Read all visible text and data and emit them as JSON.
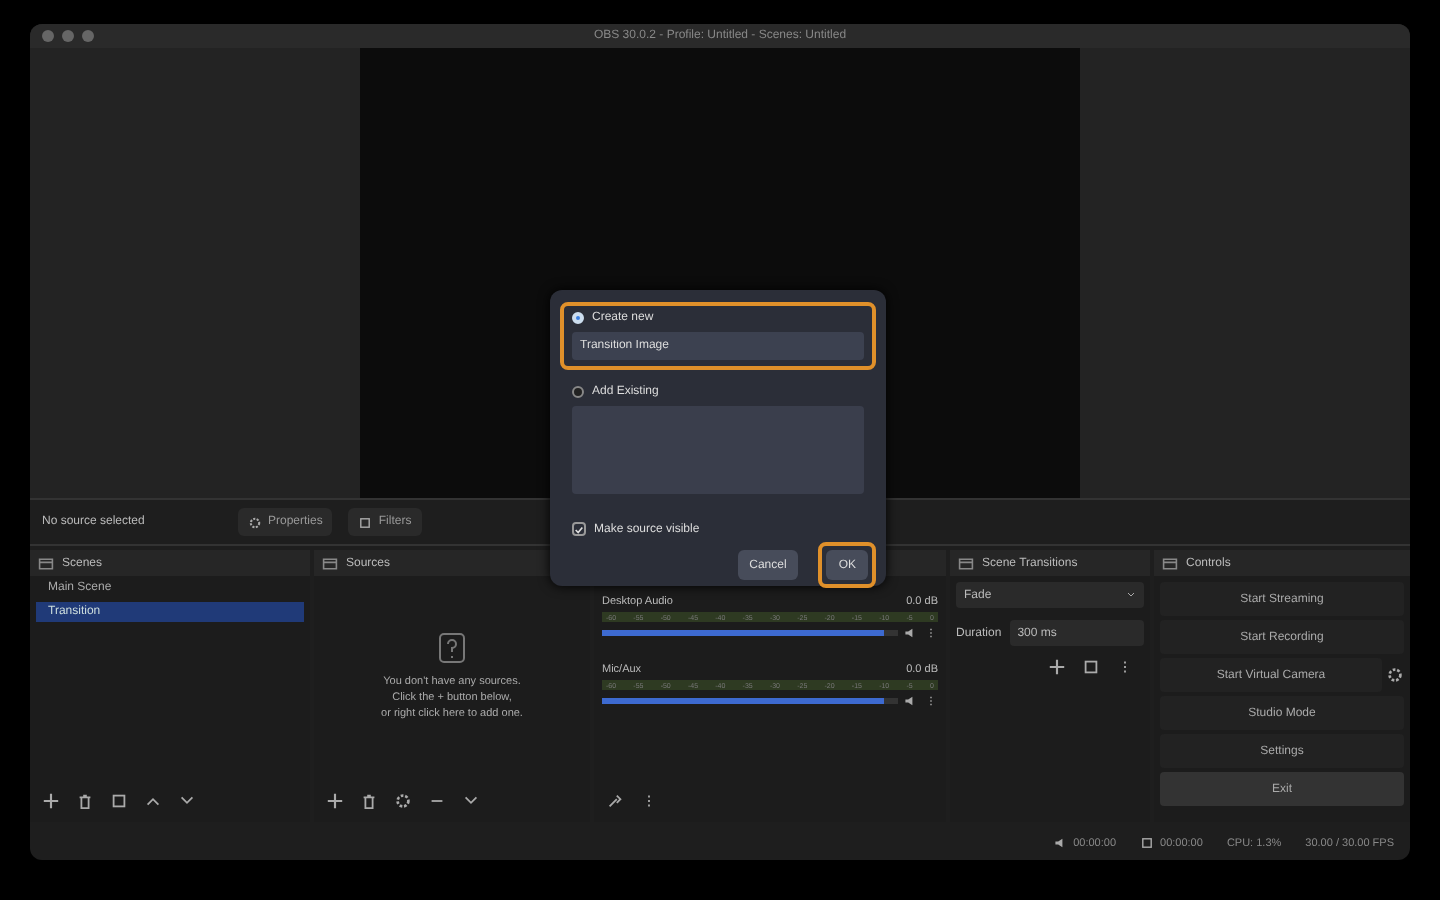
{
  "window": {
    "title": "OBS 30.0.2 - Profile: Untitled - Scenes: Untitled"
  },
  "source_toolbar": {
    "status": "No source selected",
    "buttons": [
      {
        "kind": "properties",
        "label": "Properties"
      },
      {
        "kind": "filters",
        "label": "Filters"
      }
    ]
  },
  "scenes": {
    "title": "Scenes",
    "items": [
      {
        "label": "Main Scene",
        "selected": false
      },
      {
        "label": "Transition",
        "selected": true
      }
    ]
  },
  "sources": {
    "title": "Sources",
    "empty_message": [
      "You don't have any sources.",
      "Click the + button below,",
      "or right click here to add one."
    ]
  },
  "mixer": {
    "channels": [
      {
        "name": "Desktop Audio",
        "reading": "0.0 dB",
        "level": 0.95,
        "scale": [
          "-60",
          "-55",
          "-50",
          "-45",
          "-40",
          "-35",
          "-30",
          "-25",
          "-20",
          "-15",
          "-10",
          "-5",
          "0"
        ]
      },
      {
        "name": "Mic/Aux",
        "reading": "0.0 dB",
        "level": 0.95,
        "scale": [
          "-60",
          "-55",
          "-50",
          "-45",
          "-40",
          "-35",
          "-30",
          "-25",
          "-20",
          "-15",
          "-10",
          "-5",
          "0"
        ]
      }
    ]
  },
  "transitions": {
    "title": "Scene Transitions",
    "transition": "Fade",
    "duration_label": "Duration",
    "duration": "300 ms"
  },
  "controls": {
    "title": "Controls",
    "buttons": [
      {
        "label": "Start Streaming",
        "kind": "plain"
      },
      {
        "label": "Start Recording",
        "kind": "plain"
      },
      {
        "label": "Start Virtual Camera",
        "kind": "with-settings"
      },
      {
        "label": "Studio Mode",
        "kind": "plain"
      },
      {
        "label": "Settings",
        "kind": "plain"
      },
      {
        "label": "Exit",
        "kind": "exit"
      }
    ]
  },
  "status_bar": {
    "stream_time": "00:00:00",
    "record_time": "00:00:00",
    "cpu": "CPU: 1.3%",
    "fps": "30.00 / 30.00 FPS"
  },
  "dialog": {
    "options": [
      {
        "kind": "create",
        "label": "Create new",
        "selected": true,
        "highlighted": true,
        "value": "Transition Image"
      },
      {
        "kind": "existing",
        "label": "Add Existing",
        "selected": false,
        "highlighted": false
      }
    ],
    "visible_label": "Make source visible",
    "visible_checked": true,
    "buttons": [
      {
        "label": "Cancel",
        "highlighted": false
      },
      {
        "label": "OK",
        "highlighted": true
      }
    ]
  }
}
